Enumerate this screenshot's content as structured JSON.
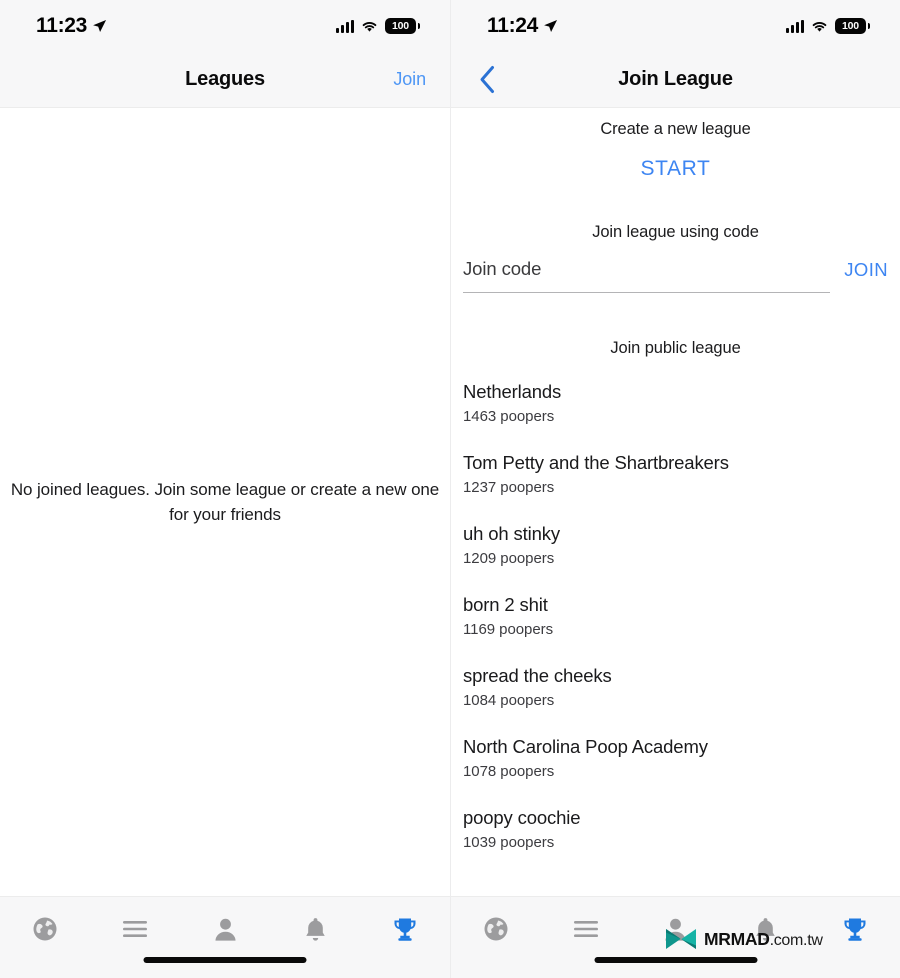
{
  "colors": {
    "accent_blue": "#3d85f2",
    "nav_link_blue": "#4d96f5",
    "tab_active_blue": "#1f7ae0",
    "tab_inactive_grey": "#999999",
    "watermark_teal": "#12978f",
    "header_bg": "#f7f7f8"
  },
  "left_screen": {
    "status_bar": {
      "time": "11:23",
      "location_icon": "location-arrow-icon",
      "signal_icon": "cellular-signal-icon",
      "wifi_icon": "wifi-icon",
      "battery_level": "100"
    },
    "nav": {
      "title": "Leagues",
      "action_label": "Join"
    },
    "empty_state_message": "No joined leagues. Join some league or create a new one for your friends",
    "tabs": [
      {
        "name": "globe",
        "icon": "globe-icon",
        "active": false
      },
      {
        "name": "feed",
        "icon": "list-lines-icon",
        "active": false
      },
      {
        "name": "profile",
        "icon": "person-icon",
        "active": false
      },
      {
        "name": "notifications",
        "icon": "bell-icon",
        "active": false
      },
      {
        "name": "leagues",
        "icon": "trophy-icon",
        "active": true
      }
    ]
  },
  "right_screen": {
    "status_bar": {
      "time": "11:24",
      "location_icon": "location-arrow-icon",
      "signal_icon": "cellular-signal-icon",
      "wifi_icon": "wifi-icon",
      "battery_level": "100"
    },
    "nav": {
      "back_icon": "chevron-left-icon",
      "title": "Join League"
    },
    "create_section": {
      "label": "Create a new league",
      "button_label": "START"
    },
    "code_section": {
      "label": "Join league using code",
      "input_value": "",
      "input_placeholder": "Join code",
      "button_label": "JOIN"
    },
    "public_section": {
      "label": "Join public league",
      "leagues": [
        {
          "name": "Netherlands",
          "members": "1463 poopers"
        },
        {
          "name": "Tom Petty and the Shartbreakers",
          "members": "1237 poopers"
        },
        {
          "name": "uh oh stinky",
          "members": "1209 poopers"
        },
        {
          "name": "born 2 shit",
          "members": "1169 poopers"
        },
        {
          "name": "spread the cheeks",
          "members": "1084 poopers"
        },
        {
          "name": "North Carolina Poop Academy",
          "members": "1078 poopers"
        },
        {
          "name": "poopy coochie",
          "members": "1039 poopers"
        }
      ]
    },
    "tabs": [
      {
        "name": "globe",
        "icon": "globe-icon",
        "active": false
      },
      {
        "name": "feed",
        "icon": "list-lines-icon",
        "active": false
      },
      {
        "name": "profile",
        "icon": "person-icon",
        "active": false
      },
      {
        "name": "notifications",
        "icon": "bell-icon",
        "active": false
      },
      {
        "name": "leagues",
        "icon": "trophy-icon",
        "active": true
      }
    ]
  },
  "watermark": {
    "logo_icon": "mrmad-bowtie-logo-icon",
    "brand": "MRMAD",
    "domain": ".com.tw"
  }
}
